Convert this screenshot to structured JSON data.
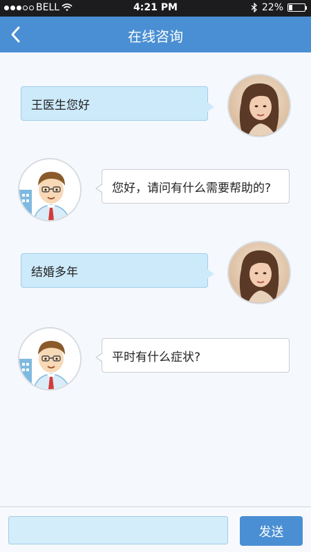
{
  "status_bar": {
    "carrier": "BELL",
    "time": "4:21 PM",
    "battery_text": "22%",
    "battery_level": 0.22,
    "signal_bars_filled": 3,
    "signal_bars_total": 5
  },
  "header": {
    "back_icon": "chevron-left-icon",
    "title": "在线咨询"
  },
  "messages": [
    {
      "sender": "user",
      "text": "王医生您好"
    },
    {
      "sender": "doctor",
      "text": "您好，请问有什么需要帮助的?"
    },
    {
      "sender": "user",
      "text": "结婚多年"
    },
    {
      "sender": "doctor",
      "text": "平时有什么症状?"
    }
  ],
  "composer": {
    "input_value": "",
    "send_label": "发送"
  },
  "colors": {
    "primary": "#4a8fd3",
    "user_bubble": "#cdeafb",
    "doctor_bubble": "#ffffff",
    "status_bar": "#1c1c1e"
  }
}
